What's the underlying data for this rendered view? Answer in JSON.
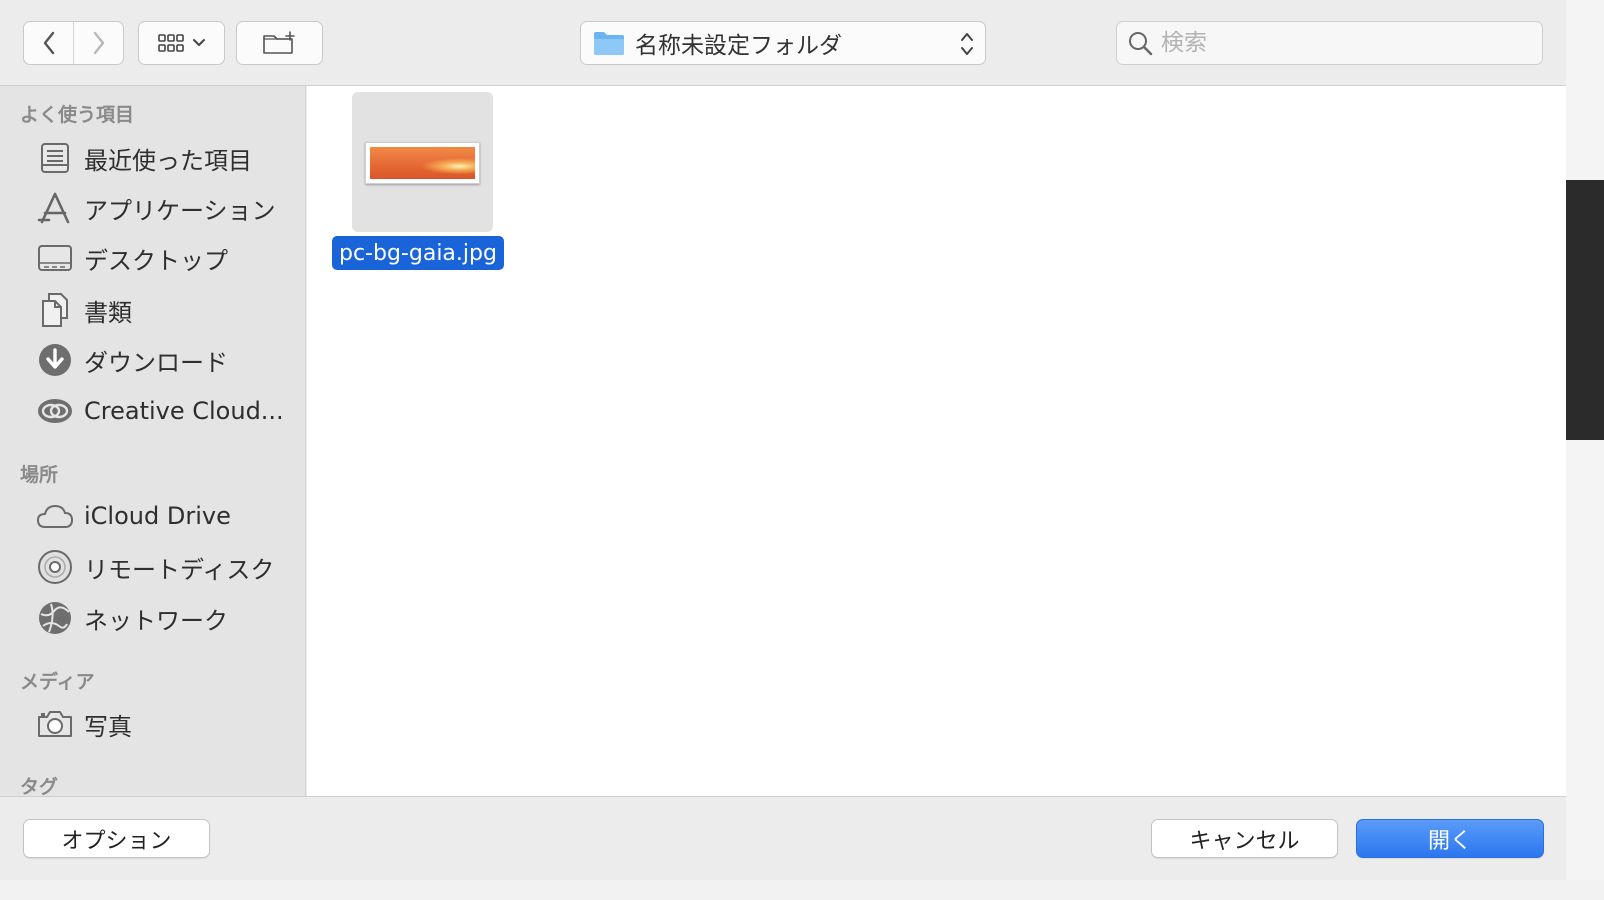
{
  "toolbar": {
    "back_icon": "chevron-left-icon",
    "forward_icon": "chevron-right-icon",
    "view_icon": "icon-grid-icon",
    "new_folder_icon": "new-folder-icon",
    "path": {
      "label": "名称未設定フォルダ",
      "icon": "folder-icon"
    },
    "search": {
      "placeholder": "検索"
    }
  },
  "sidebar": {
    "favorites": {
      "heading": "よく使う項目",
      "items": [
        {
          "label": "最近使った項目",
          "icon": "recents-icon"
        },
        {
          "label": "アプリケーション",
          "icon": "applications-icon"
        },
        {
          "label": "デスクトップ",
          "icon": "desktop-icon"
        },
        {
          "label": "書類",
          "icon": "documents-icon"
        },
        {
          "label": "ダウンロード",
          "icon": "downloads-icon"
        },
        {
          "label": "Creative Cloud...",
          "icon": "creative-cloud-icon"
        }
      ]
    },
    "locations": {
      "heading": "場所",
      "items": [
        {
          "label": "iCloud Drive",
          "icon": "cloud-icon"
        },
        {
          "label": "リモートディスク",
          "icon": "disc-icon"
        },
        {
          "label": "ネットワーク",
          "icon": "network-globe-icon"
        }
      ]
    },
    "media": {
      "heading": "メディア",
      "items": [
        {
          "label": "写真",
          "icon": "camera-icon"
        }
      ]
    },
    "tags": {
      "heading": "タグ"
    }
  },
  "content": {
    "files": [
      {
        "name": "pc-bg-gaia.jpg",
        "selected": true
      }
    ]
  },
  "footer": {
    "options_label": "オプション",
    "cancel_label": "キャンセル",
    "open_label": "開く"
  },
  "colors": {
    "selection": "#1a64d9",
    "primary_button": "#2b77ef",
    "folder": "#6cb4f0"
  }
}
